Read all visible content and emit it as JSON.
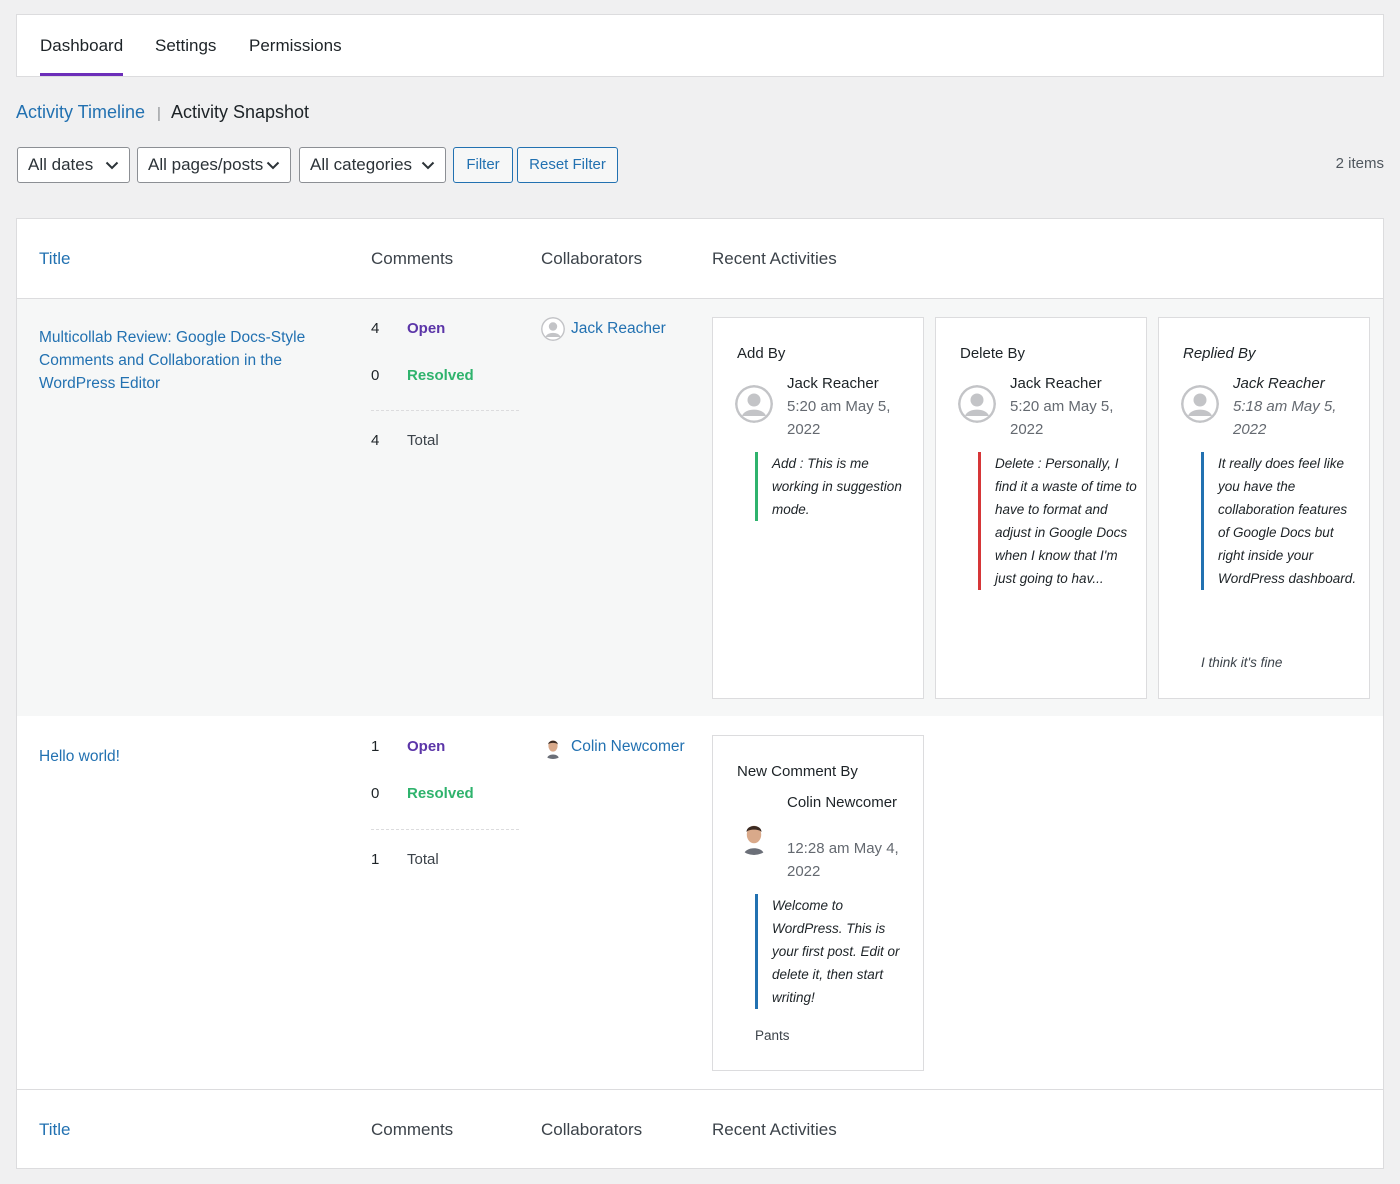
{
  "tabs": [
    {
      "label": "Dashboard",
      "active": true
    },
    {
      "label": "Settings",
      "active": false
    },
    {
      "label": "Permissions",
      "active": false
    }
  ],
  "subnav": {
    "timeline": "Activity Timeline",
    "separator": "|",
    "snapshot": "Activity Snapshot"
  },
  "filters": {
    "dates": "All dates",
    "pages": "All pages/posts",
    "categories": "All categories",
    "filter_button": "Filter",
    "reset_button": "Reset Filter",
    "item_count": "2 items"
  },
  "columns": {
    "title": "Title",
    "comments": "Comments",
    "collaborators": "Collaborators",
    "activities": "Recent Activities"
  },
  "rows": [
    {
      "title": "Multicollab Review: Google Docs-Style Comments and Collaboration in the WordPress Editor",
      "open_count": "4",
      "open_label": "Open",
      "resolved_count": "0",
      "resolved_label": "Resolved",
      "total_count": "4",
      "total_label": "Total",
      "collaborator": "Jack Reacher",
      "activities": [
        {
          "heading": "Add By",
          "user": "Jack Reacher",
          "time": "5:20 am May 5, 2022",
          "text": "Add : This is me working in suggestion mode.",
          "accent": "#2fb36d"
        },
        {
          "heading": "Delete By",
          "user": "Jack Reacher",
          "time": "5:20 am May 5, 2022",
          "text": "Delete : Personally, I find it a waste of time to have to format and adjust in Google Docs when I know that I'm just going to hav...",
          "accent": "#d63638"
        },
        {
          "heading": "Replied By",
          "user": "Jack Reacher",
          "time": "5:18 am May 5, 2022",
          "text": "It really does feel like you have the collaboration features of Google Docs but right inside your WordPress dashboard.",
          "reply": "I think it's fine",
          "accent": "#2271b1"
        }
      ]
    },
    {
      "title": "Hello world!",
      "open_count": "1",
      "open_label": "Open",
      "resolved_count": "0",
      "resolved_label": "Resolved",
      "total_count": "1",
      "total_label": "Total",
      "collaborator": "Colin Newcomer",
      "activities": [
        {
          "heading": "New Comment By",
          "user": "Colin Newcomer",
          "time": "12:28 am May 4, 2022",
          "text": "Welcome to WordPress. This is your first post. Edit or delete it, then start writing!",
          "reply": "Pants",
          "accent": "#2271b1"
        }
      ]
    }
  ],
  "icons": {
    "dropdown": "chevron-down-icon",
    "default_avatar": "default-avatar-icon",
    "user_photo": "user-photo-avatar"
  },
  "colors": {
    "accent_purple": "#6c2eb9",
    "link": "#2271b1",
    "open": "#5b35a8",
    "resolved": "#2fb36d",
    "delete": "#d63638"
  }
}
